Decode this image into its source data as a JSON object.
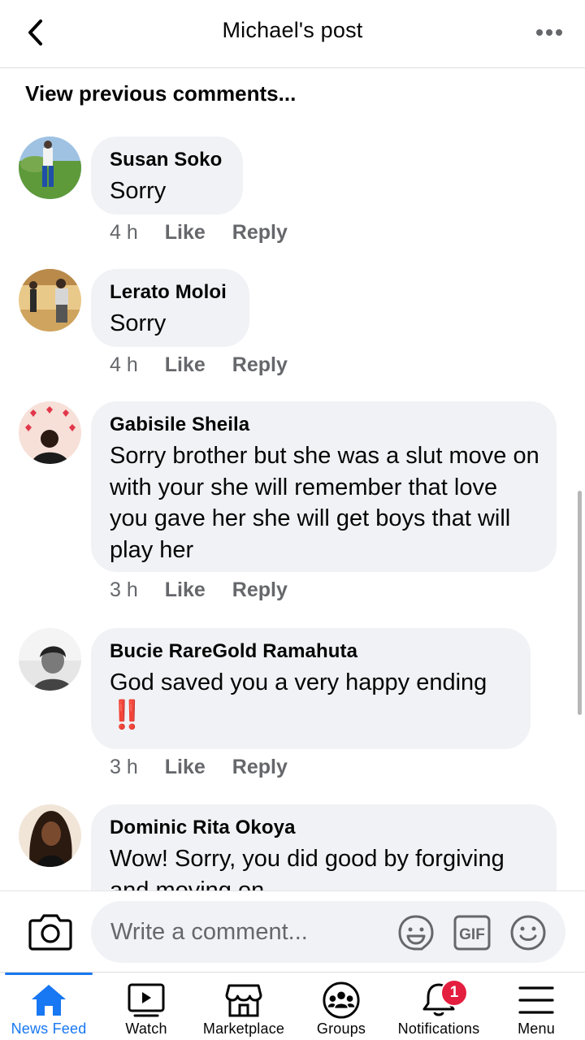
{
  "header": {
    "title": "Michael's post",
    "back_icon": "chevron-left-icon",
    "more_icon": "more-horizontal-icon"
  },
  "feed": {
    "view_previous": "View previous comments...",
    "comments": [
      {
        "author": "Susan Soko",
        "text": "Sorry",
        "time": "4 h",
        "like": "Like",
        "reply": "Reply"
      },
      {
        "author": "Lerato Moloi",
        "text": "Sorry",
        "time": "4 h",
        "like": "Like",
        "reply": "Reply"
      },
      {
        "author": "Gabisile Sheila",
        "text": "Sorry brother but she was a slut move on with your she will remember that love you gave her she will get boys that will play her",
        "time": "3 h",
        "like": "Like",
        "reply": "Reply"
      },
      {
        "author": "Bucie RareGold Ramahuta",
        "text": "God saved you a very happy ending",
        "emoji": "‼️",
        "time": "3 h",
        "like": "Like",
        "reply": "Reply"
      },
      {
        "author": "Dominic Rita Okoya",
        "text": "Wow! Sorry, you did good by forgiving and moving on"
      }
    ]
  },
  "composer": {
    "placeholder": "Write a comment...",
    "camera_icon": "camera-icon",
    "sticker_icon": "sticker-icon",
    "gif_label": "GIF",
    "emoji_icon": "smiley-icon"
  },
  "tabbar": {
    "tabs": [
      {
        "label": "News Feed",
        "icon": "home-icon",
        "active": true
      },
      {
        "label": "Watch",
        "icon": "watch-icon"
      },
      {
        "label": "Marketplace",
        "icon": "marketplace-icon"
      },
      {
        "label": "Groups",
        "icon": "groups-icon"
      },
      {
        "label": "Notifications",
        "icon": "bell-icon",
        "badge": "1"
      },
      {
        "label": "Menu",
        "icon": "menu-icon"
      }
    ]
  },
  "colors": {
    "accent": "#1877f2",
    "bubble": "#f0f2f5",
    "meta_text": "#65676b",
    "badge": "#e41e3f"
  }
}
